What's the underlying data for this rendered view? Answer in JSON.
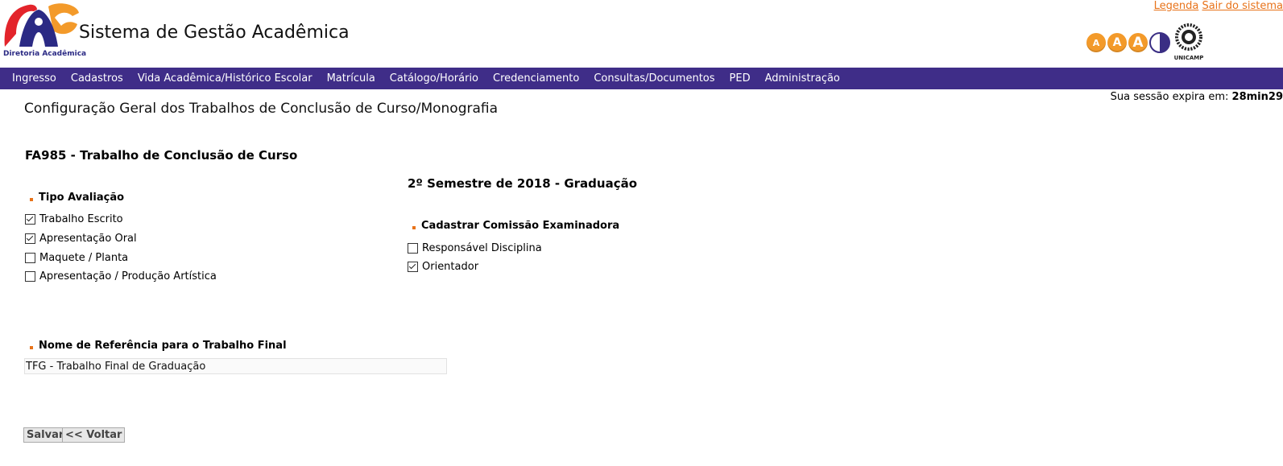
{
  "header": {
    "logo_caption": "Diretoria Acadêmica",
    "app_title": "Sistema de Gestão Acadêmica",
    "top_links": [
      "Legenda",
      "Sair do sistema"
    ],
    "accessibility": [
      "A",
      "A",
      "A"
    ],
    "institution_logo_text": "UNICAMP"
  },
  "nav": {
    "items": [
      "Ingresso",
      "Cadastros",
      "Vida Acadêmica/Histórico Escolar",
      "Matrícula",
      "Catálogo/Horário",
      "Credenciamento",
      "Consultas/Documentos",
      "PED",
      "Administração"
    ]
  },
  "session": {
    "label": "Sua sessão expira em:",
    "time": "28min29"
  },
  "page": {
    "title": "Configuração Geral dos Trabalhos de Conclusão de Curso/Monografia",
    "course": "FA985 - Trabalho de Conclusão de Curso",
    "semester": "2º Semestre de 2018 - Graduação"
  },
  "tipo_avaliacao": {
    "heading": "Tipo Avaliação",
    "options": [
      {
        "label": "Trabalho Escrito",
        "checked": true
      },
      {
        "label": "Apresentação Oral",
        "checked": true
      },
      {
        "label": "Maquete / Planta",
        "checked": false
      },
      {
        "label": "Apresentação / Produção Artística",
        "checked": false
      }
    ]
  },
  "comissao": {
    "heading": "Cadastrar Comissão Examinadora",
    "options": [
      {
        "label": "Responsável Disciplina",
        "checked": false
      },
      {
        "label": "Orientador",
        "checked": true
      }
    ]
  },
  "referencia": {
    "heading": "Nome de Referência para o Trabalho Final",
    "value": "TFG - Trabalho Final de Graduação"
  },
  "buttons": {
    "save": "Salvar",
    "back": "<< Voltar"
  },
  "colors": {
    "nav_bg": "#3f2d88",
    "accent": "#e8731a",
    "acc_button": "#f39a2a"
  },
  "icons": [
    "diretoria-academica-logo",
    "contrast-icon",
    "unicamp-logo"
  ]
}
